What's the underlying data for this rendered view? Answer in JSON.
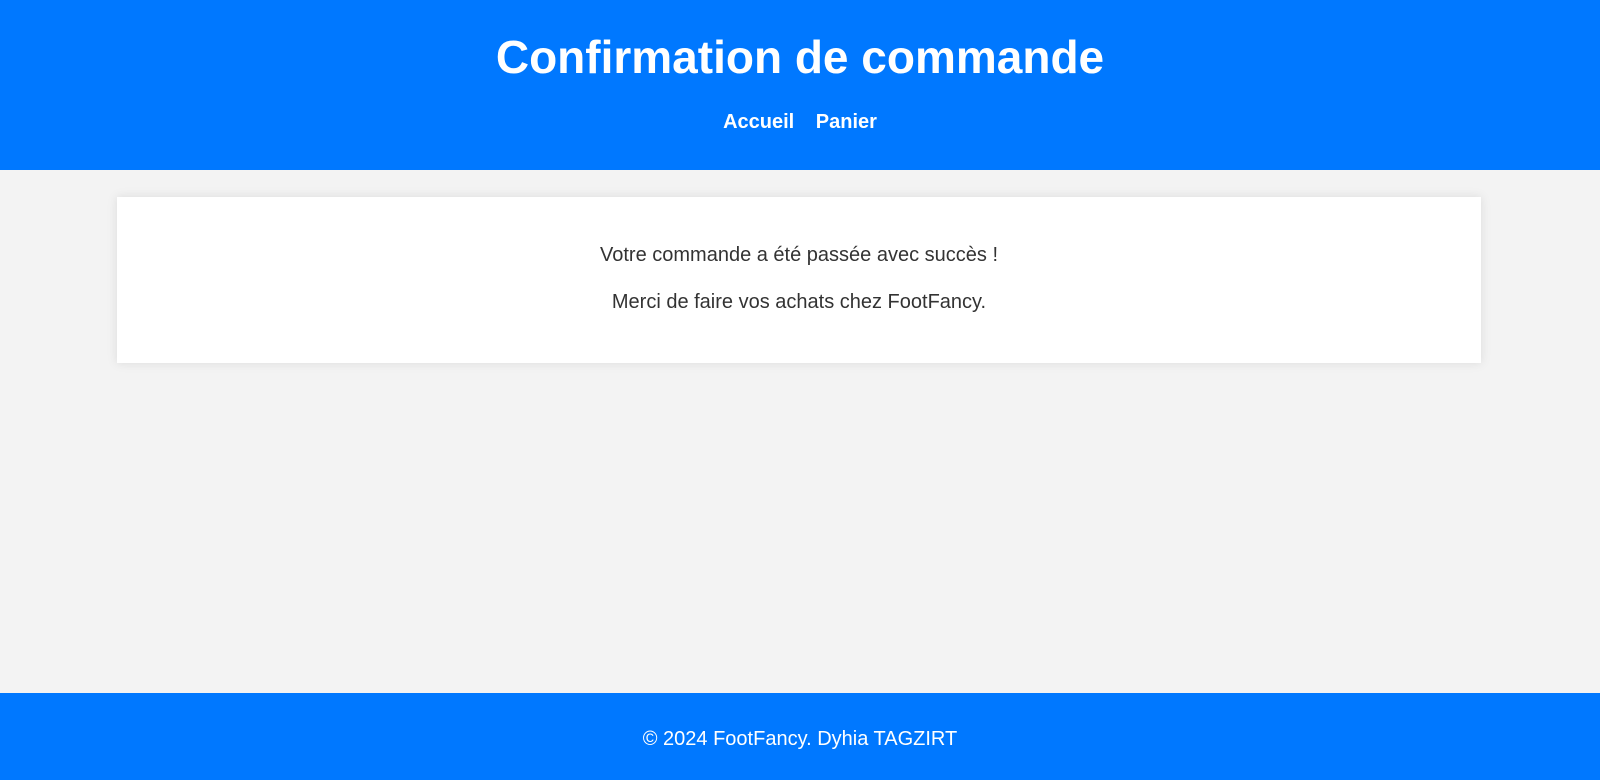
{
  "colors": {
    "header_bg": "#0078ff",
    "page_bg": "#f3f3f3",
    "card_bg": "#ffffff",
    "text": "#333333",
    "header_text": "#ffffff"
  },
  "header": {
    "title": "Confirmation de commande",
    "nav": [
      {
        "label": "Accueil"
      },
      {
        "label": "Panier"
      }
    ]
  },
  "main": {
    "message_success": "Votre commande a été passée avec succès !",
    "message_thanks": "Merci de faire vos achats chez FootFancy."
  },
  "footer": {
    "text": "© 2024 FootFancy. Dyhia TAGZIRT"
  }
}
